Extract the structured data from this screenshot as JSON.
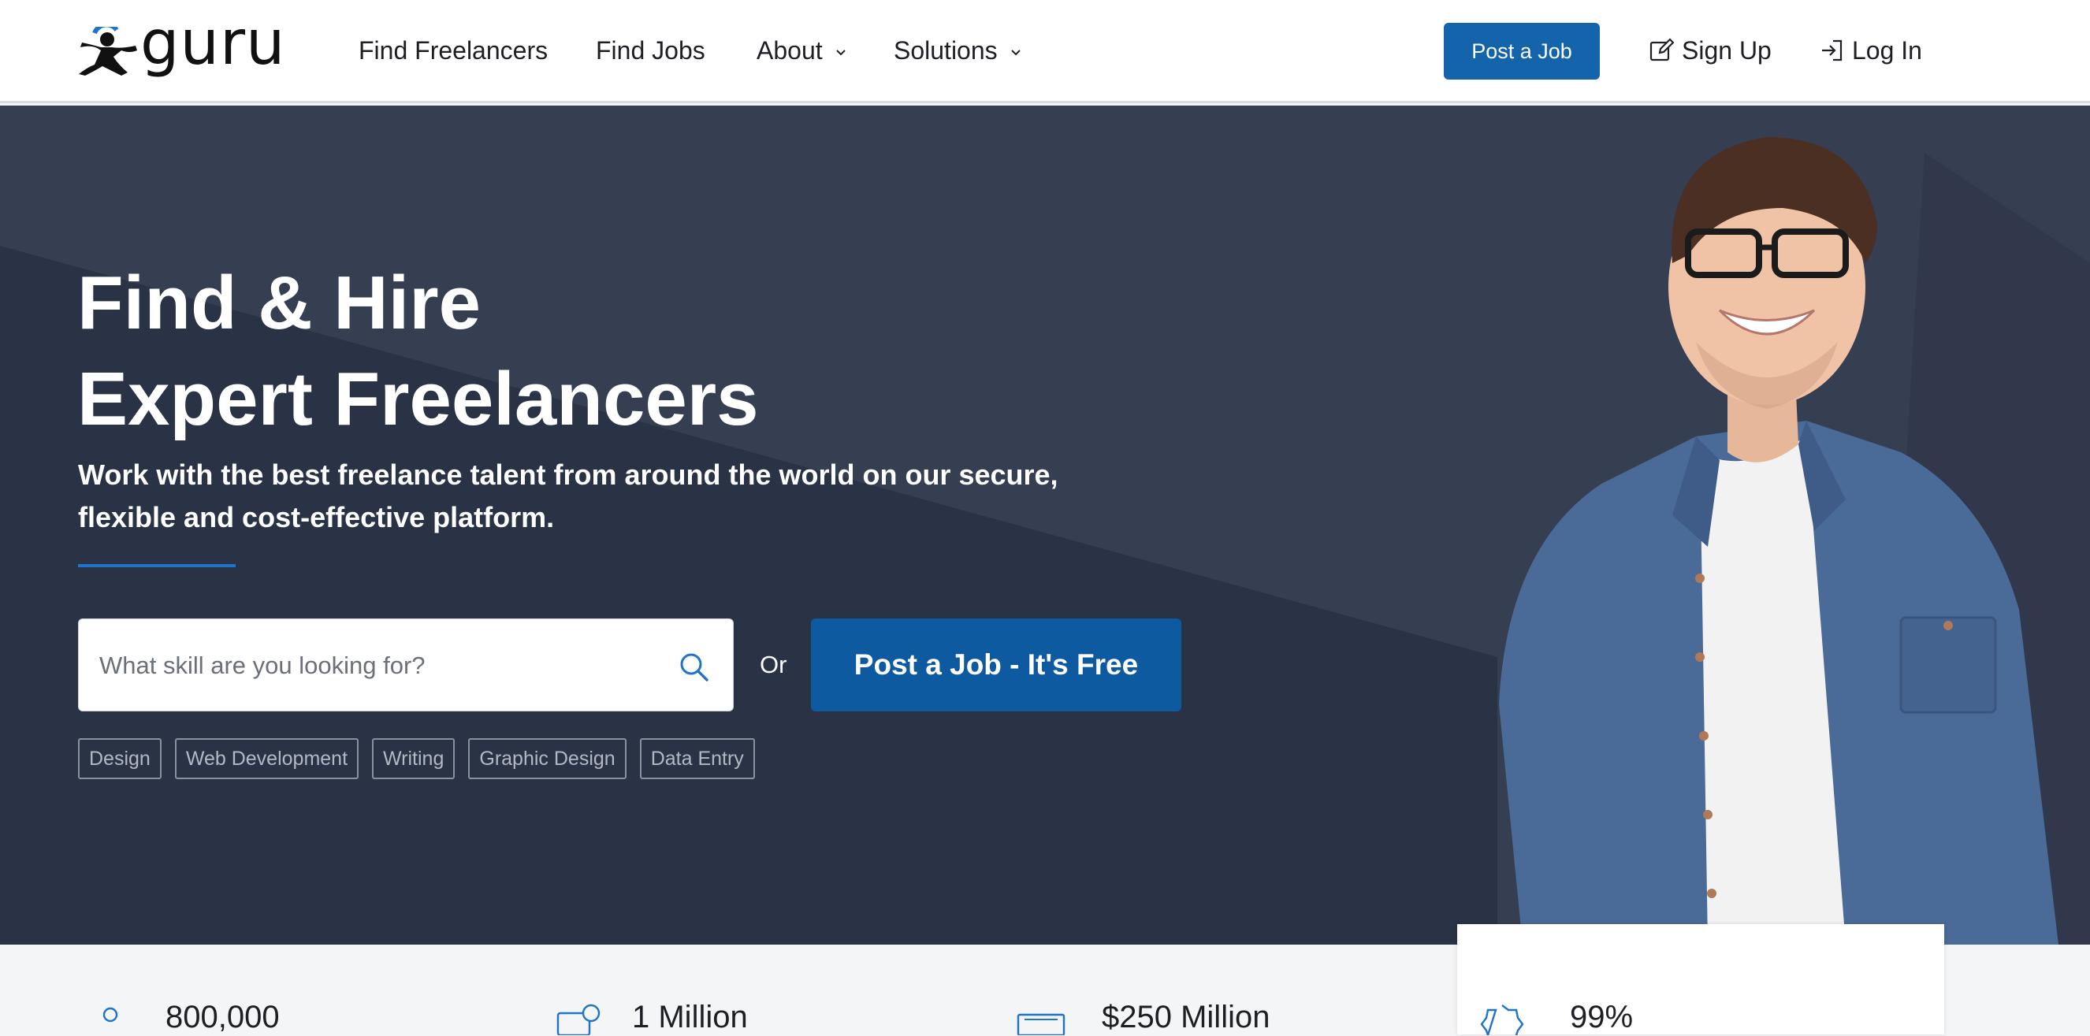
{
  "brand": {
    "name": "guru",
    "accent": "#1464ab"
  },
  "nav": {
    "links": [
      "Find Freelancers",
      "Find Jobs",
      "About",
      "Solutions"
    ],
    "post_job": "Post a Job",
    "sign_up": "Sign Up",
    "log_in": "Log In"
  },
  "hero": {
    "title_line1": "Find & Hire",
    "title_line2": "Expert Freelancers",
    "subtitle_line1": "Work with the best freelance talent from around the world on our secure,",
    "subtitle_line2": "flexible and cost-effective platform.",
    "search_placeholder": "What skill are you looking for?",
    "or": "Or",
    "cta": "Post a Job - It's Free",
    "tags": [
      "Design",
      "Web Development",
      "Writing",
      "Graphic Design",
      "Data Entry"
    ]
  },
  "stats": [
    {
      "value": "800,000",
      "icon": "people-icon"
    },
    {
      "value": "1 Million",
      "icon": "payment-icon"
    },
    {
      "value": "$250 Million",
      "icon": "money-icon"
    },
    {
      "value": "99%",
      "icon": "badge-icon"
    }
  ]
}
